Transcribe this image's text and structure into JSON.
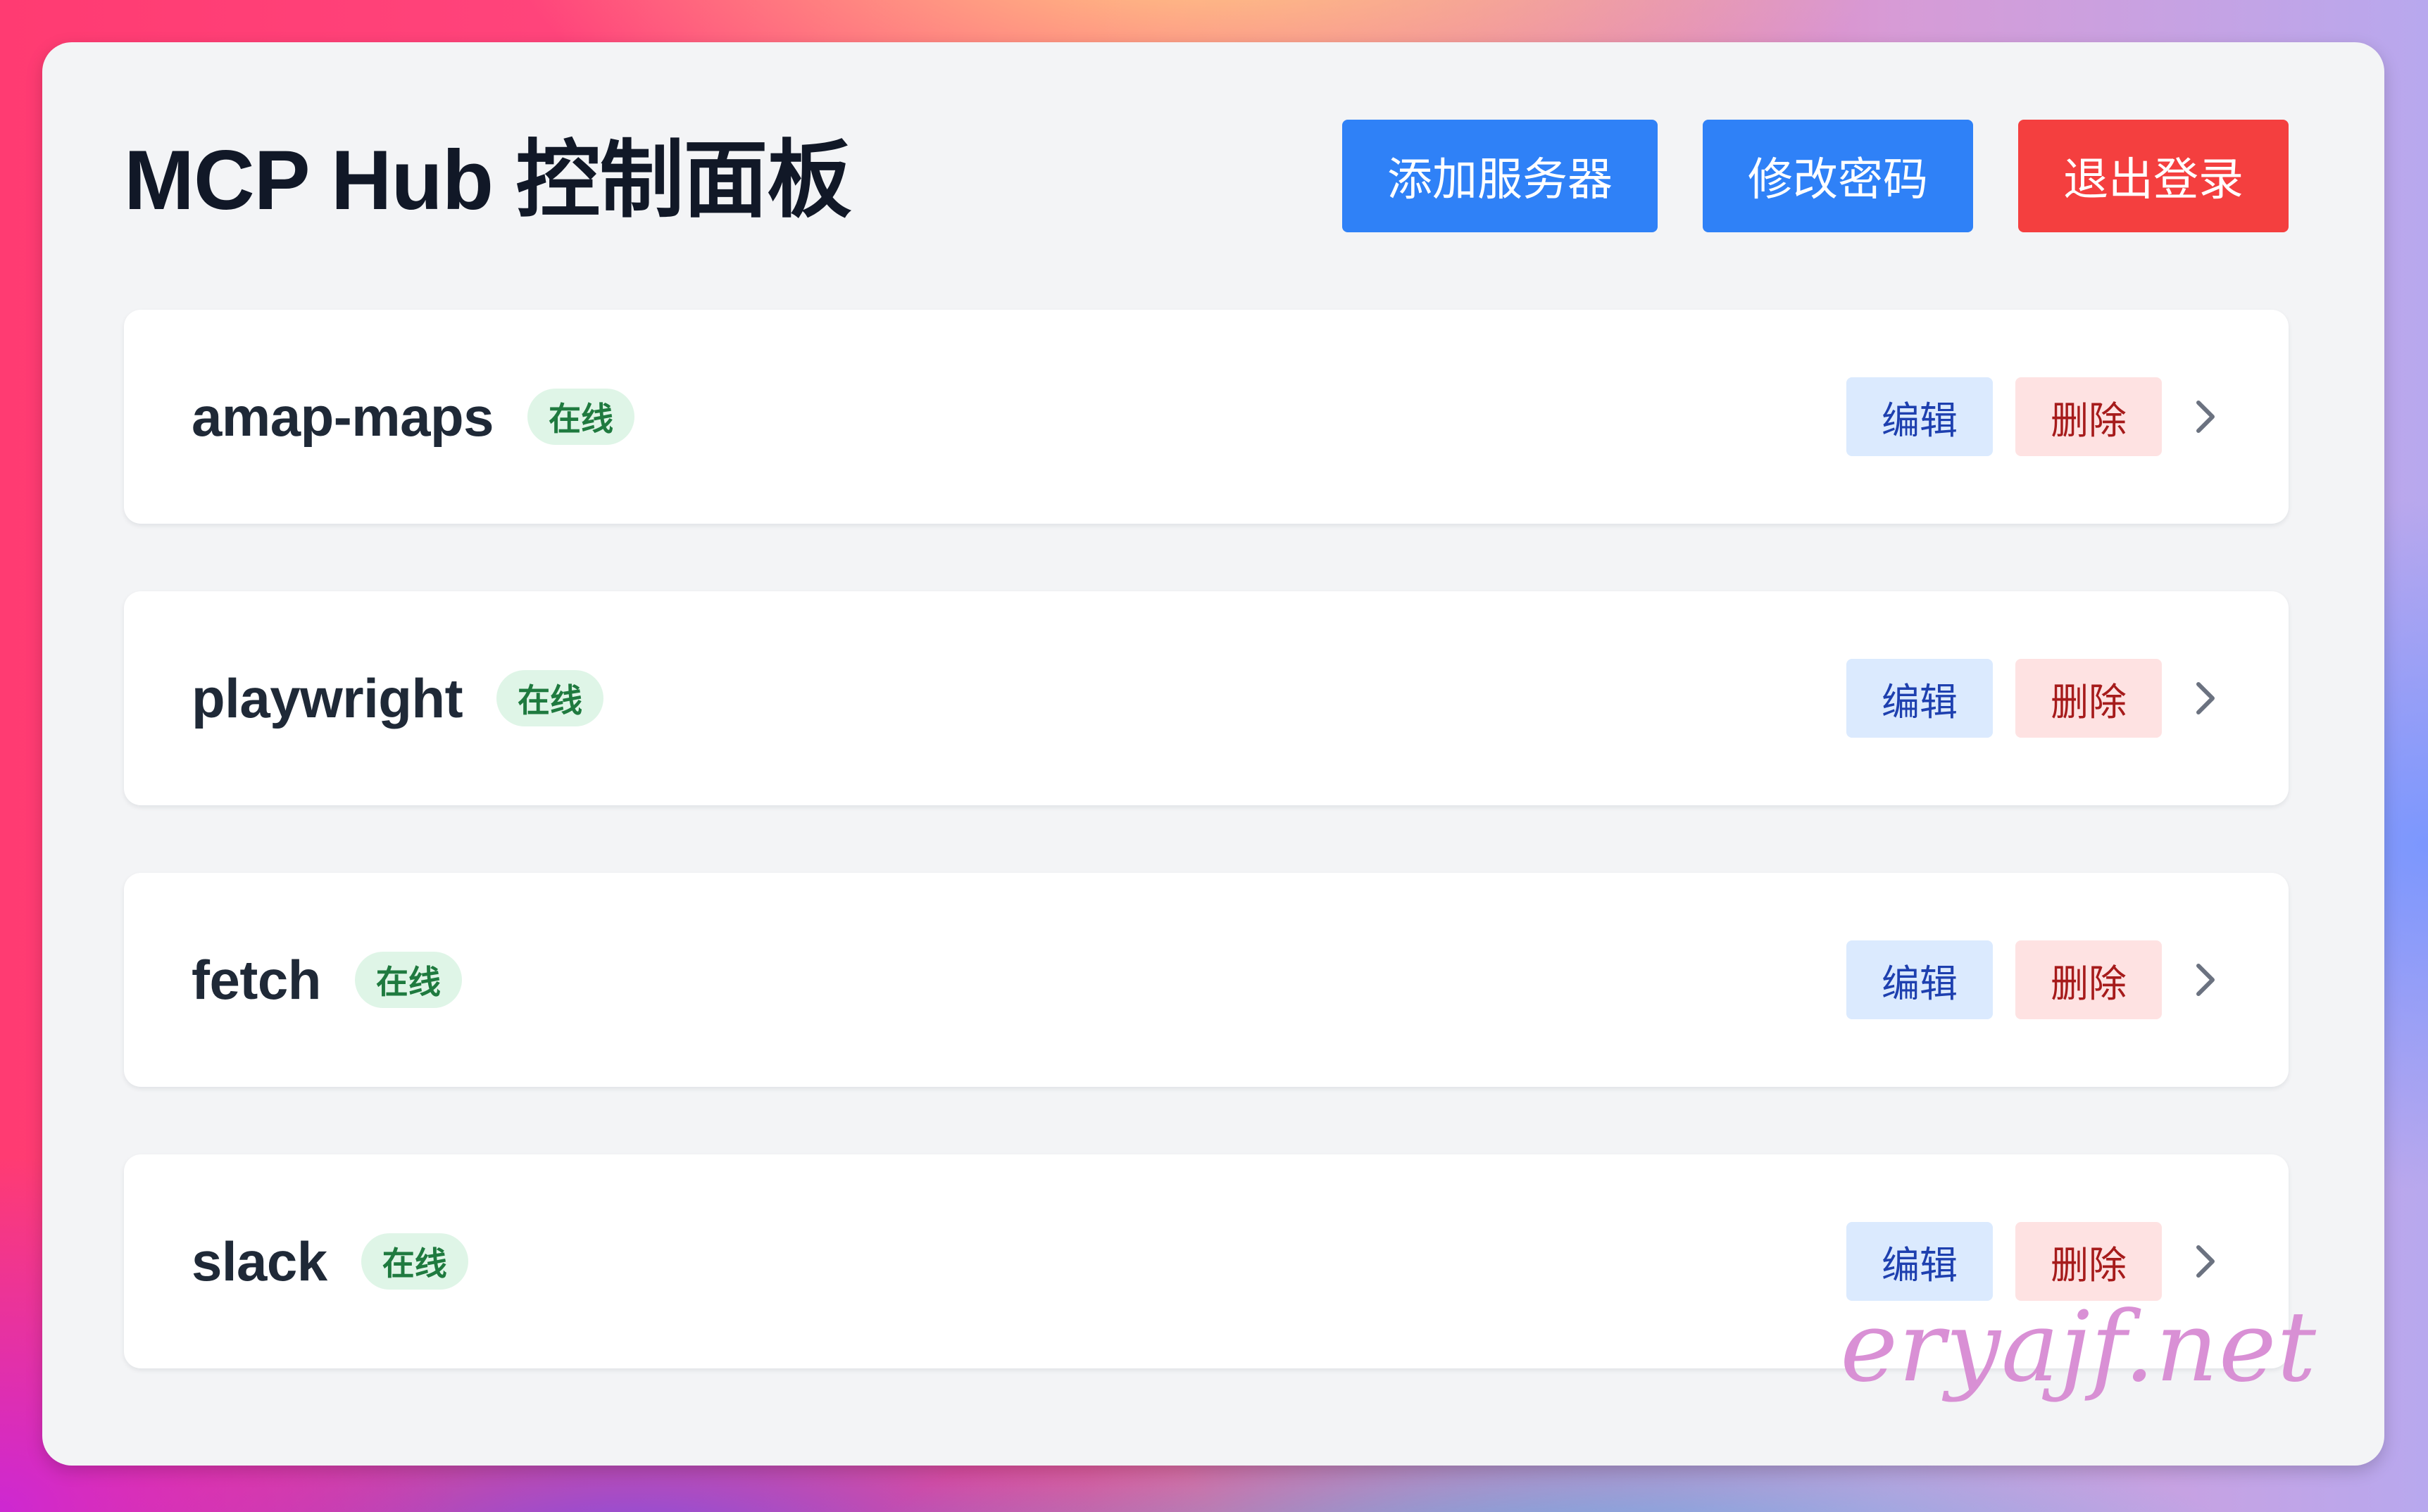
{
  "app": {
    "title": "MCP Hub 控制面板"
  },
  "toolbar": {
    "add_server_label": "添加服务器",
    "change_password_label": "修改密码",
    "logout_label": "退出登录"
  },
  "servers": [
    {
      "name": "amap-maps",
      "status": "在线",
      "edit_label": "编辑",
      "delete_label": "删除"
    },
    {
      "name": "playwright",
      "status": "在线",
      "edit_label": "编辑",
      "delete_label": "删除"
    },
    {
      "name": "fetch",
      "status": "在线",
      "edit_label": "编辑",
      "delete_label": "删除"
    },
    {
      "name": "slack",
      "status": "在线",
      "edit_label": "编辑",
      "delete_label": "删除"
    }
  ],
  "watermark": "eryajf.net",
  "colors": {
    "primary": "#2f81f7",
    "danger": "#f43f3f",
    "status_bg": "#dff5e7",
    "status_text": "#1f7a3f",
    "edit_bg": "#dbeafe",
    "edit_text": "#1e40af",
    "delete_bg": "#fee2e2",
    "delete_text": "#a61b1b"
  },
  "icons": {
    "expand": "chevron-right-icon"
  }
}
